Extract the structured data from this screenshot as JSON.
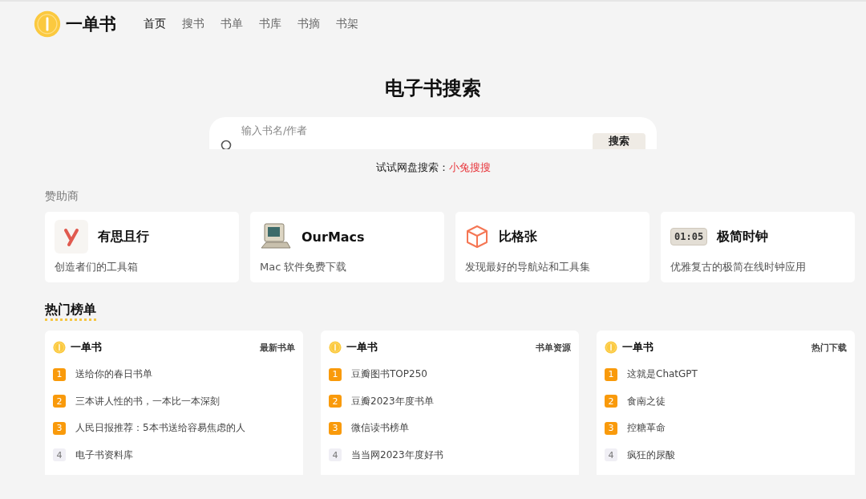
{
  "header": {
    "logo_text": "一单书",
    "nav": [
      {
        "label": "首页",
        "selected": true
      },
      {
        "label": "搜书",
        "selected": false
      },
      {
        "label": "书单",
        "selected": false
      },
      {
        "label": "书库",
        "selected": false
      },
      {
        "label": "书摘",
        "selected": false
      },
      {
        "label": "书架",
        "selected": false
      }
    ]
  },
  "search": {
    "title": "电子书搜索",
    "placeholder": "输入书名/作者",
    "button": "搜索",
    "hint": "试试网盘搜索：",
    "hint_link": "小兔搜搜"
  },
  "sponsors": {
    "title": "赞助商",
    "items": [
      {
        "kind": "y",
        "name": "有思且行",
        "desc": "创造者们的工具箱"
      },
      {
        "kind": "computer",
        "name": "OurMacs",
        "desc": "Mac 软件免费下载"
      },
      {
        "kind": "cube",
        "name": "比格张",
        "desc": "发现最好的导航站和工具集"
      },
      {
        "kind": "clock",
        "name": "极简时钟",
        "desc": "优雅复古的极简在线时钟应用",
        "clock_text": "01:05"
      }
    ]
  },
  "rankings": {
    "title": "热门榜单",
    "lists": [
      {
        "brand": "一单书",
        "tag": "最新书单",
        "items": [
          {
            "rank": "1",
            "title": "送给你的春日书单",
            "top": true
          },
          {
            "rank": "2",
            "title": "三本讲人性的书，一本比一本深刻",
            "top": true
          },
          {
            "rank": "3",
            "title": "人民日报推荐：5本书送给容易焦虑的人",
            "top": true
          },
          {
            "rank": "4",
            "title": "电子书资料库",
            "top": false
          }
        ]
      },
      {
        "brand": "一单书",
        "tag": "书单资源",
        "items": [
          {
            "rank": "1",
            "title": "豆瓣图书TOP250",
            "top": true
          },
          {
            "rank": "2",
            "title": "豆瓣2023年度书单",
            "top": true
          },
          {
            "rank": "3",
            "title": "微信读书榜单",
            "top": true
          },
          {
            "rank": "4",
            "title": "当当网2023年度好书",
            "top": false
          }
        ]
      },
      {
        "brand": "一单书",
        "tag": "热门下载",
        "items": [
          {
            "rank": "1",
            "title": "这就是ChatGPT",
            "top": true
          },
          {
            "rank": "2",
            "title": "食南之徒",
            "top": true
          },
          {
            "rank": "3",
            "title": "控糖革命",
            "top": true
          },
          {
            "rank": "4",
            "title": "疯狂的尿酸",
            "top": false
          }
        ]
      }
    ]
  }
}
